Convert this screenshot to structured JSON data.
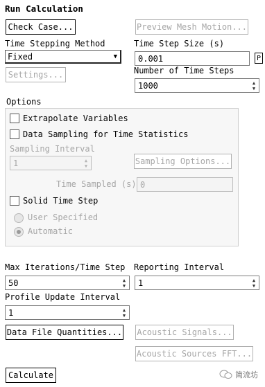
{
  "panel": {
    "title": "Run Calculation"
  },
  "buttons": {
    "check_case": "Check Case...",
    "preview_mesh_motion": "Preview Mesh Motion...",
    "settings": "Settings...",
    "sampling_options": "Sampling Options...",
    "data_file_quantities": "Data File Quantities...",
    "acoustic_signals": "Acoustic Signals...",
    "acoustic_sources_fft": "Acoustic Sources FFT...",
    "calculate": "Calculate"
  },
  "time_stepping": {
    "label": "Time Stepping Method",
    "value": "Fixed"
  },
  "time_step_size": {
    "label": "Time Step Size (s)",
    "value": "0.001",
    "param_badge": "P"
  },
  "number_of_time_steps": {
    "label": "Number of Time Steps",
    "value": "1000"
  },
  "options": {
    "label": "Options",
    "extrapolate_variables": "Extrapolate Variables",
    "data_sampling": "Data Sampling for Time Statistics",
    "sampling_interval_label": "Sampling Interval",
    "sampling_interval_value": "1",
    "time_sampled_label": "Time Sampled (s)",
    "time_sampled_value": "0",
    "solid_time_step": "Solid Time Step",
    "user_specified": "User Specified",
    "automatic": "Automatic"
  },
  "max_iterations": {
    "label": "Max Iterations/Time Step",
    "value": "50"
  },
  "reporting_interval": {
    "label": "Reporting Interval",
    "value": "1"
  },
  "profile_update": {
    "label": "Profile Update Interval",
    "value": "1"
  },
  "watermark": "简流坊"
}
